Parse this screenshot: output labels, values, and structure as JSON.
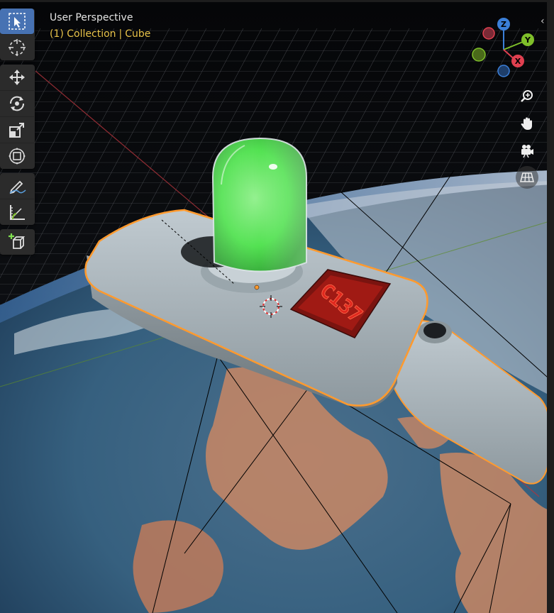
{
  "viewport": {
    "view_name": "User Perspective",
    "collection_text": "(1) Collection",
    "separator": "|",
    "active_object": "Cube",
    "header_color": "#e8c34a"
  },
  "toolbar": {
    "tools": [
      {
        "name": "select-box",
        "icon": "cursor-arrow-icon",
        "active": true
      },
      {
        "name": "cursor",
        "icon": "3d-cursor-icon",
        "active": false
      },
      {
        "name": "move",
        "icon": "move-arrows-icon",
        "active": false
      },
      {
        "name": "rotate",
        "icon": "rotate-icon",
        "active": false
      },
      {
        "name": "scale",
        "icon": "scale-icon",
        "active": false
      },
      {
        "name": "transform",
        "icon": "transform-icon",
        "active": false
      },
      {
        "name": "annotate",
        "icon": "pencil-icon",
        "active": false
      },
      {
        "name": "measure",
        "icon": "ruler-icon",
        "active": false
      },
      {
        "name": "add-cube",
        "icon": "add-cube-icon",
        "active": false
      }
    ],
    "accent_color": "#4772b3"
  },
  "gizmo": {
    "z_label": "Z",
    "y_label": "Y",
    "x_label": "X",
    "z_color": "#3b7fd8",
    "y_color": "#7fbf2a",
    "x_color": "#e04050"
  },
  "nav_tools": [
    "zoom-icon",
    "hand-pan-icon",
    "camera-icon",
    "grid-perspective-icon"
  ],
  "device": {
    "display_text": "C137",
    "display_color": "#e0281e",
    "fluid_color": "#4be04a",
    "selection_outline": "#ff9a2e"
  }
}
